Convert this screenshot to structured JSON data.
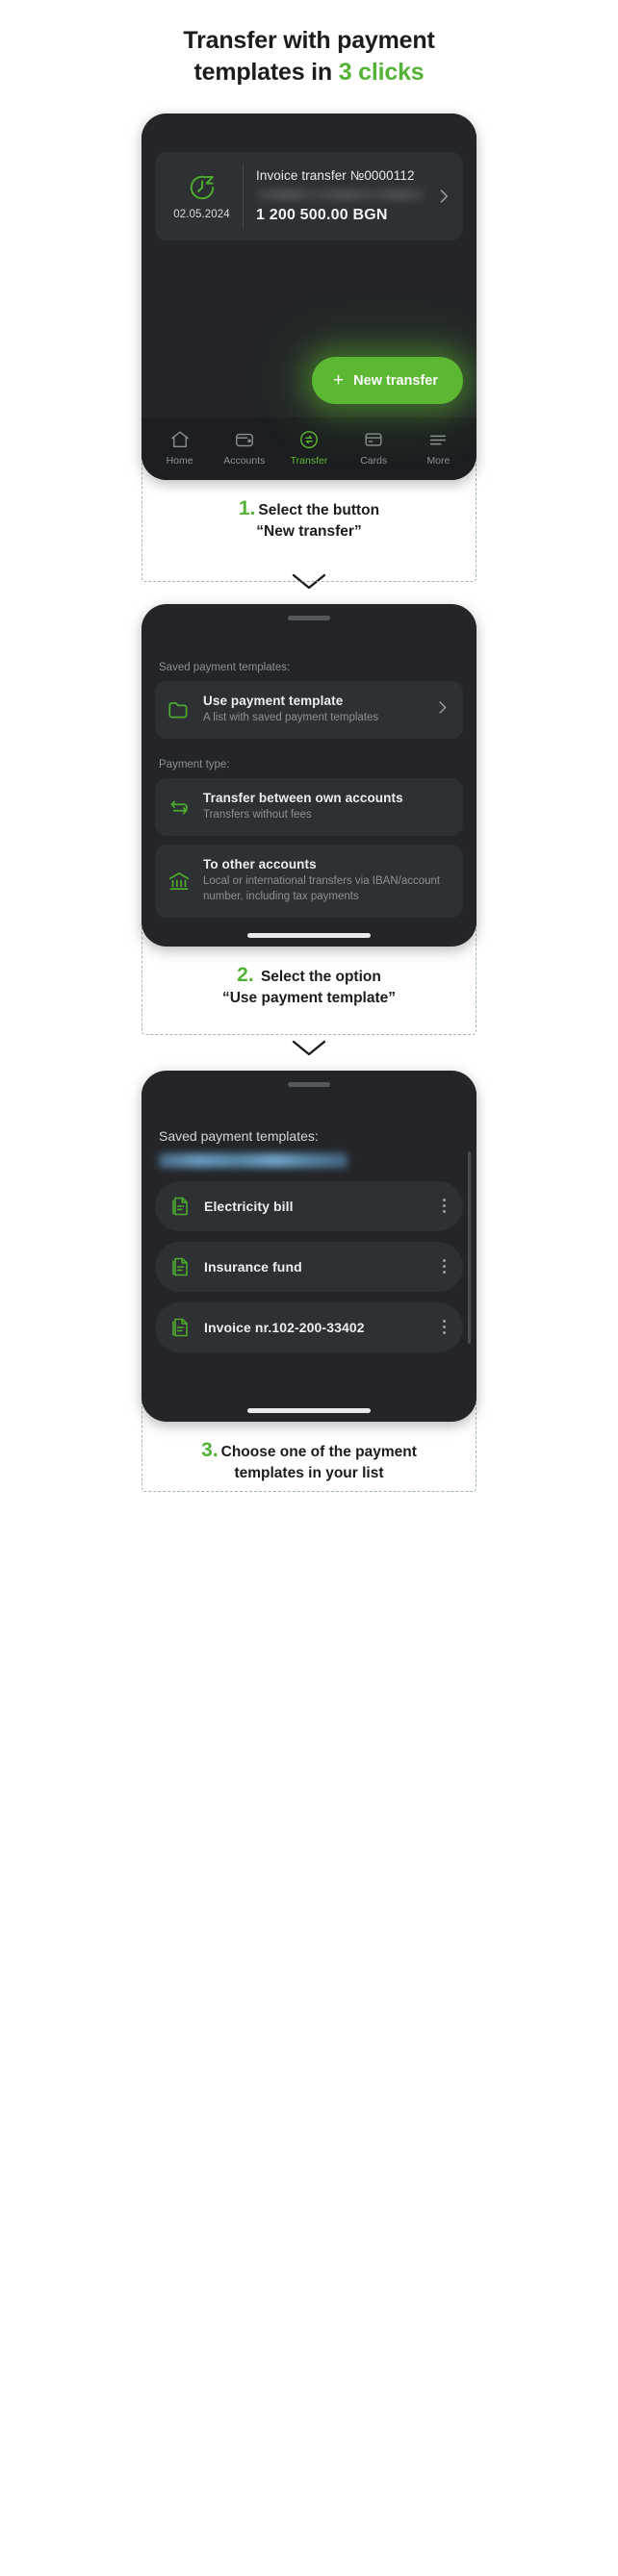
{
  "headline": {
    "line1": "Transfer with payment",
    "line2_plain": "templates in ",
    "line2_accent": "3 clicks"
  },
  "colors": {
    "accent_green": "#53b336",
    "button_green": "#5cb832",
    "phone_bg": "#232528",
    "card_bg": "#2e3134",
    "nav_bg": "#1c1e21",
    "muted_text": "#8b9095"
  },
  "step1": {
    "transaction": {
      "icon": "clock-snooze-icon",
      "date": "02.05.2024",
      "title": "Invoice transfer №0000112",
      "masked_line": "",
      "amount": "1 200 500.00 BGN",
      "chevron": "chevron-right-icon"
    },
    "new_transfer_button": {
      "plus": "+",
      "label": "New transfer"
    },
    "bottom_nav": [
      {
        "icon": "home-icon",
        "label": "Home",
        "active": false
      },
      {
        "icon": "wallet-icon",
        "label": "Accounts",
        "active": false
      },
      {
        "icon": "transfer-icon",
        "label": "Transfer",
        "active": true
      },
      {
        "icon": "card-icon",
        "label": "Cards",
        "active": false
      },
      {
        "icon": "more-icon",
        "label": "More",
        "active": false
      }
    ],
    "caption": {
      "number": "1.",
      "line1": "Select the button",
      "line2": "“New transfer”"
    }
  },
  "step2": {
    "saved_label": "Saved payment templates:",
    "template_option": {
      "icon": "folder-icon",
      "title": "Use payment template",
      "subtitle": "A list with saved payment templates",
      "chevron": "chevron-right-icon"
    },
    "payment_type_label": "Payment type:",
    "options": [
      {
        "icon": "transfer-arrows-icon",
        "title": "Transfer between own accounts",
        "subtitle": "Transfers without fees"
      },
      {
        "icon": "bank-icon",
        "title": "To other accounts",
        "subtitle": "Local or international transfers via IBAN/account number, including tax payments"
      }
    ],
    "caption": {
      "number": "2.",
      "line1": "Select the option",
      "line2": "“Use payment template”"
    }
  },
  "step3": {
    "saved_label": "Saved payment templates:",
    "masked_line": "",
    "templates": [
      {
        "icon": "document-icon",
        "name": "Electricity bill",
        "menu": "kebab-menu-icon"
      },
      {
        "icon": "document-icon",
        "name": "Insurance fund",
        "menu": "kebab-menu-icon"
      },
      {
        "icon": "document-icon",
        "name": "Invoice nr.102-200-33402",
        "menu": "kebab-menu-icon"
      }
    ],
    "caption": {
      "number": "3.",
      "line1": "Choose one of the payment",
      "line2": "templates in your list"
    }
  }
}
